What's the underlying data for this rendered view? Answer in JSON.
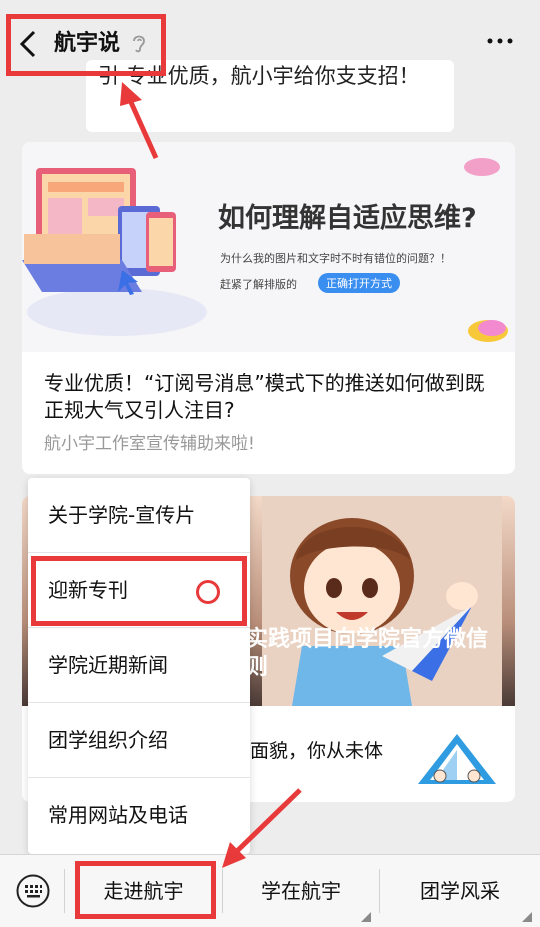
{
  "header": {
    "title": "航宇说",
    "back_icon": "back-chevron-icon",
    "ear_icon": "ear-icon",
    "more_icon": "more-dots-icon"
  },
  "prev_message": {
    "text": "引 专业优质，航小宇给你支支招！"
  },
  "article1": {
    "banner_headline": "如何理解自适应思维?",
    "banner_subline": "为什么我的图片和文字时不时有错位的问题？！",
    "banner_subline2": "赶紧了解排版的",
    "banner_pill": "正确打开方式",
    "title": "专业优质！“订阅号消息”模式下的推送如何做到既正规大气又引人注目?",
    "subtitle": "航小宇工作室宣传辅助来啦!"
  },
  "article2": {
    "overlay": "实践项目向学院官方微信\n则",
    "text": "面貌，你从未体"
  },
  "popup_menu": {
    "items": [
      {
        "label": "关于学院-宣传片"
      },
      {
        "label": "迎新专刊"
      },
      {
        "label": "学院近期新闻"
      },
      {
        "label": "团学组织介绍"
      },
      {
        "label": "常用网站及电话"
      }
    ]
  },
  "bottom_menu": {
    "keyboard_icon": "keyboard-icon",
    "tabs": [
      {
        "label": "走进航宇"
      },
      {
        "label": "学在航宇"
      },
      {
        "label": "团学风采"
      }
    ]
  },
  "colors": {
    "highlight": "#e83a3a",
    "background": "#ededed",
    "accent_blue": "#3a8ef0"
  }
}
